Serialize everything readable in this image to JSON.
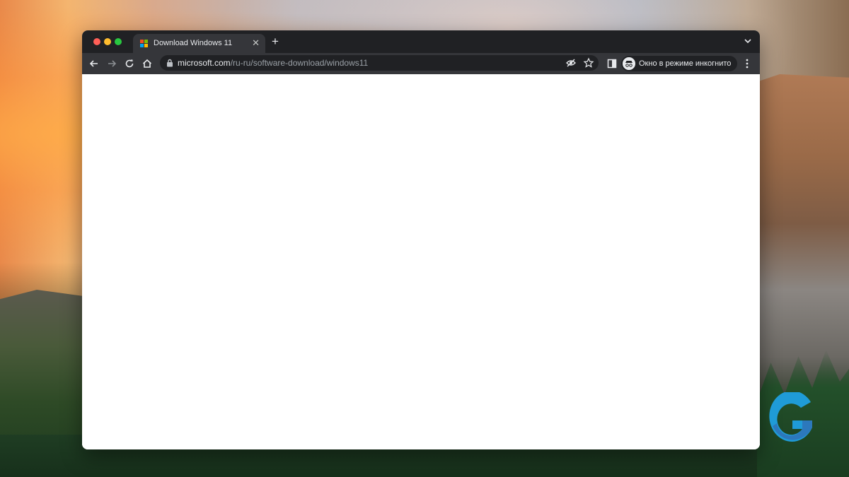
{
  "browser": {
    "tab": {
      "title": "Download Windows 11",
      "favicon": "microsoft-logo-icon",
      "close_icon": "close-icon"
    },
    "new_tab_label": "+",
    "tab_search_icon": "chevron-down-icon",
    "toolbar": {
      "back_icon": "arrow-left-icon",
      "forward_icon": "arrow-right-icon",
      "reload_icon": "reload-icon",
      "home_icon": "home-icon",
      "url_host": "microsoft.com",
      "url_path": "/ru-ru/software-download/windows11",
      "lock_icon": "lock-icon",
      "tracking_icon": "eye-off-icon",
      "bookmark_icon": "star-icon",
      "side_panel_icon": "side-panel-icon",
      "incognito_label": "Окно в режиме инкогнито",
      "menu_icon": "more-vert-icon"
    },
    "colors": {
      "frame": "#202124",
      "toolbar": "#35363a",
      "text": "#e8eaed",
      "muted": "#9aa0a6"
    }
  },
  "watermark": {
    "logo_icon": "g-logo-icon"
  }
}
